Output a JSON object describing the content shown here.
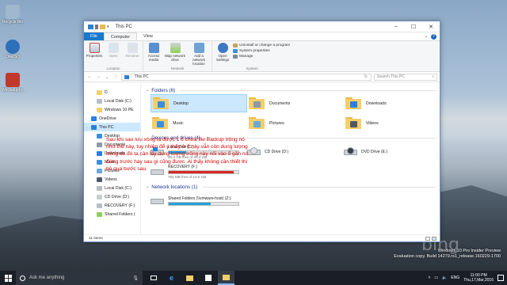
{
  "desktop": {
    "icons": [
      {
        "label": "Recycle Bin",
        "color": "#9fb7cf"
      },
      {
        "label": "OneISO",
        "color": "#2d6fb8"
      },
      {
        "label": "WinSetupFr...",
        "color": "#c0392b"
      }
    ],
    "watermark": {
      "line1": "Windows 10 Pro Insider Preview",
      "line2": "Evaluation copy. Build 14279.rs1_release.160229-1700"
    }
  },
  "window": {
    "title": "This PC",
    "tabs": [
      "File",
      "Computer",
      "View"
    ],
    "ribbon": {
      "location": {
        "name": "Location",
        "buttons": [
          "Properties",
          "Open",
          "Rename"
        ]
      },
      "network": {
        "name": "Network",
        "buttons": [
          "Access media",
          "Map network drive",
          "Add a network location"
        ]
      },
      "system": {
        "name": "System",
        "open_settings": "Open Settings",
        "items": [
          "Uninstall or change a program",
          "System properties",
          "Manage"
        ]
      }
    },
    "address": {
      "path": "This PC",
      "search_placeholder": "Search This PC"
    },
    "nav": [
      {
        "label": "D",
        "icon": "folder-icon",
        "level": 1
      },
      {
        "label": "Local Disk (C:)",
        "icon": "drive-icon",
        "level": 1
      },
      {
        "label": "Windows 10 PE",
        "icon": "folder-icon",
        "level": 1
      },
      {
        "label": "OneDrive",
        "icon": "onedrive-icon",
        "level": 0
      },
      {
        "label": "This PC",
        "icon": "pc-icon",
        "level": 0,
        "selected": true
      },
      {
        "label": "Desktop",
        "icon": "desktop-icon",
        "level": 1
      },
      {
        "label": "Documents",
        "icon": "documents-icon",
        "level": 1
      },
      {
        "label": "Downloads",
        "icon": "downloads-icon",
        "level": 1
      },
      {
        "label": "Music",
        "icon": "music-icon",
        "level": 1
      },
      {
        "label": "Pictures",
        "icon": "pictures-icon",
        "level": 1
      },
      {
        "label": "Videos",
        "icon": "videos-icon",
        "level": 1
      },
      {
        "label": "Local Disk (C:)",
        "icon": "drive-icon",
        "level": 1
      },
      {
        "label": "CD Drive (D:)",
        "icon": "cd-icon",
        "level": 1
      },
      {
        "label": "RECOVERY (F:)",
        "icon": "drive-icon",
        "level": 1
      },
      {
        "label": "Shared Folders (",
        "icon": "network-drive-icon",
        "level": 1
      }
    ],
    "sections": {
      "folders": "Folders (6)",
      "drives": "Devices and drives (4)",
      "network": "Network locations (1)"
    },
    "folders": [
      {
        "label": "Desktop",
        "glyph": "#3b8fe0",
        "selected": true
      },
      {
        "label": "Documents",
        "glyph": "#8c9aa8"
      },
      {
        "label": "Downloads",
        "glyph": "#2b7de9"
      },
      {
        "label": "Music",
        "glyph": "#3b8fe0"
      },
      {
        "label": "Pictures",
        "glyph": "#6aa9d8"
      },
      {
        "label": "Videos",
        "glyph": "#505a66"
      }
    ],
    "drives": [
      {
        "name": "Local Disk (C:)",
        "info": "30.4 GB free of 40.4 GB",
        "used": 0.25,
        "bar_color": "#26a0da",
        "type": "os"
      },
      {
        "name": "CD Drive (D:)",
        "info": "",
        "used": null,
        "type": "cd"
      },
      {
        "name": "DVD Drive (E:)",
        "info": "",
        "used": null,
        "type": "dvd"
      },
      {
        "name": "RECOVERY (F:)",
        "info": "750 MB free of 10.0 GB",
        "used": 0.93,
        "bar_color": "#da2626",
        "type": "drive"
      }
    ],
    "network_locations": [
      {
        "name": "Shared Folders (\\\\vmware-host) (Z:)",
        "info": "",
        "used": 0.6,
        "bar_color": "#26a0da"
      }
    ],
    "status": "11 items"
  },
  "note_text": "Sau khi sao lưu xong ta được 1 ổ chứa file Backup trông nó như thế này, tuy nhiên để ý thấy ở ổ này vẫn còn dung lượng trống do đó ta cần lấy dung lượng trống này nối vào ổ gần nó đứng trước hay sau gì cũng được. Ai thấy không cần thiết thì bỏ qua bước sau.",
  "taskbar": {
    "search_placeholder": "Ask me anything",
    "lang": "ENG",
    "time": "11:00 PM",
    "date": "Thu,17,Mar,2016"
  }
}
